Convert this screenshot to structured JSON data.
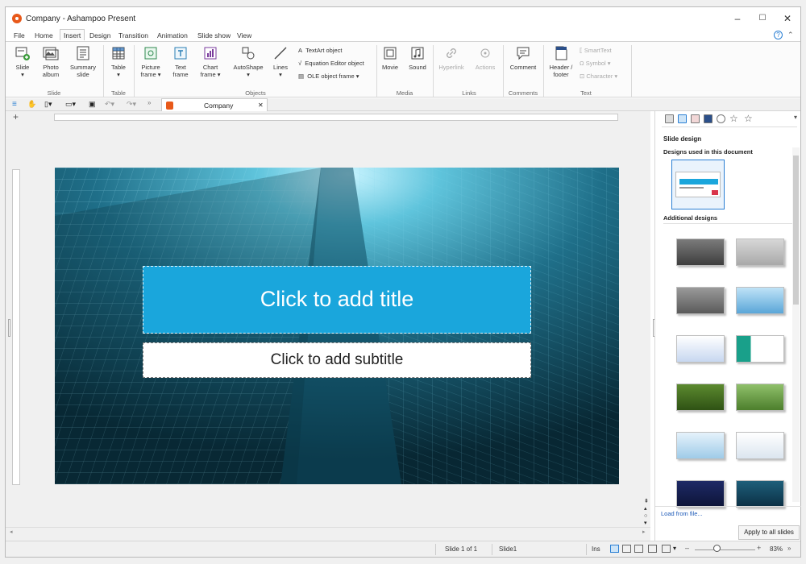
{
  "window": {
    "title": "Company - Ashampoo Present",
    "minimize": "–",
    "maximize": "☐",
    "close": "✕"
  },
  "menu": [
    "File",
    "Home",
    "Insert",
    "Design",
    "Transition",
    "Animation",
    "Slide show",
    "View"
  ],
  "ribbon": {
    "slide": {
      "label": "Slide",
      "photo_album": "Photo album",
      "summary_slide": "Summary slide",
      "group": "Slide"
    },
    "table": {
      "label": "Table",
      "group": "Table"
    },
    "objects": {
      "picture_frame": "Picture frame",
      "text_frame": "Text frame",
      "chart_frame": "Chart frame",
      "autoshape": "AutoShape",
      "lines": "Lines",
      "textart": "TextArt object",
      "equation": "Equation Editor object",
      "ole": "OLE object frame",
      "group": "Objects"
    },
    "media": {
      "movie": "Movie",
      "sound": "Sound",
      "group": "Media"
    },
    "links": {
      "hyperlink": "Hyperlink",
      "actions": "Actions",
      "group": "Links"
    },
    "comments": {
      "comment": "Comment",
      "group": "Comments"
    },
    "text": {
      "header_footer": "Header / footer",
      "smarttext": "SmartText",
      "symbol": "Symbol",
      "character": "Character",
      "group": "Text"
    }
  },
  "document_tab": {
    "name": "Company",
    "close": "✕"
  },
  "slide": {
    "title_placeholder": "Click to add title",
    "subtitle_placeholder": "Click to add subtitle"
  },
  "design_panel": {
    "title": "Slide design",
    "used_section": "Designs used in this document",
    "additional_section": "Additional designs",
    "load_link": "Load from file...",
    "apply_button": "Apply to all slides"
  },
  "status": {
    "slide_position": "Slide 1 of 1",
    "slide_name": "Slide1",
    "mode": "Ins",
    "zoom": "83%"
  },
  "colors": {
    "accent": "#1aa6dc",
    "brand": "#e8591a",
    "link": "#1d5ab8"
  }
}
